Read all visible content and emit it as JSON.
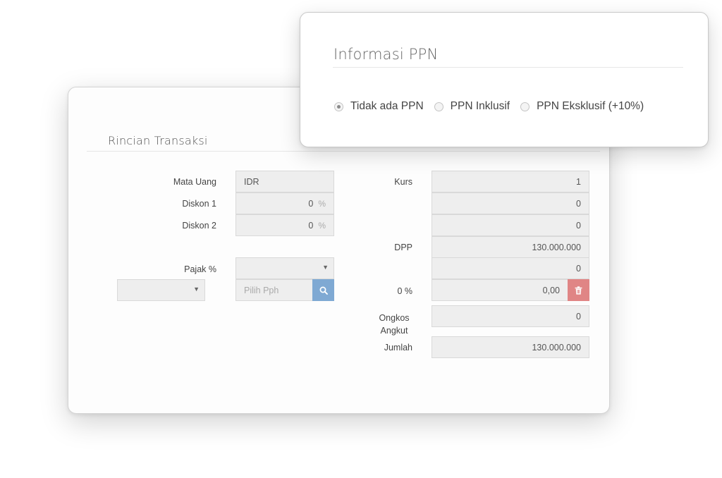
{
  "rincian": {
    "title": "Rincian Transaksi",
    "mata_uang": {
      "label": "Mata Uang",
      "value": "IDR"
    },
    "diskon1": {
      "label": "Diskon 1",
      "value": "0",
      "unit": "%"
    },
    "diskon2": {
      "label": "Diskon 2",
      "value": "0",
      "unit": "%"
    },
    "pajak": {
      "label": "Pajak %",
      "value": ""
    },
    "pph_type_select": {
      "value": ""
    },
    "pph_input": {
      "placeholder": "Pilih Pph"
    },
    "kurs": {
      "label": "Kurs",
      "value": "1"
    },
    "diskon1_amount": {
      "value": "0"
    },
    "diskon2_amount": {
      "value": "0"
    },
    "dpp": {
      "label": "DPP",
      "value": "130.000.000"
    },
    "pajak_amount": {
      "value": "0"
    },
    "pph_amount": {
      "label": "0 %",
      "value": "0,00"
    },
    "ongkos_angkut": {
      "label_line1": "Ongkos",
      "label_line2": "Angkut",
      "value": "0"
    },
    "jumlah": {
      "label": "Jumlah",
      "value": "130.000.000"
    }
  },
  "ppn": {
    "title": "Informasi PPN",
    "options": [
      {
        "label": "Tidak ada PPN",
        "checked": true
      },
      {
        "label": "PPN Inklusif",
        "checked": false
      },
      {
        "label": "PPN Eksklusif (+10%)",
        "checked": false
      }
    ]
  },
  "icons": {
    "search": "search-icon",
    "delete": "trash-icon",
    "caret": "caret-down-icon"
  },
  "colors": {
    "search_button": "#7fa9d3",
    "delete_button": "#e08585",
    "field_bg": "#eeeeee"
  }
}
